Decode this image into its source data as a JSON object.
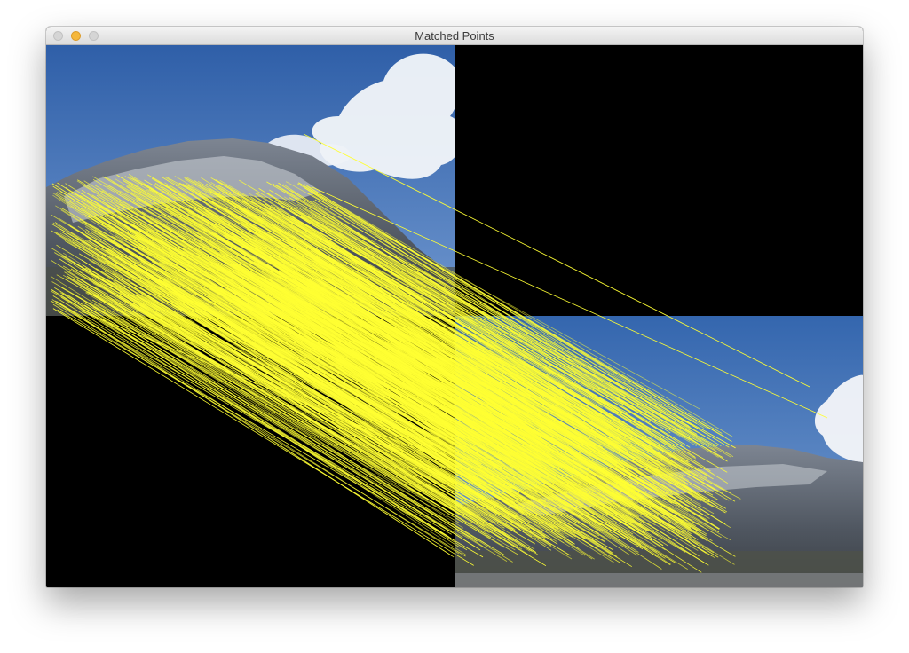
{
  "window": {
    "title": "Matched Points",
    "buttons": {
      "close": "close-icon",
      "minimize": "minimize-icon",
      "zoom": "zoom-icon"
    }
  },
  "canvas": {
    "background": "#000000",
    "match_line_color": "#ffff33",
    "sky_color": "#3c6cb1",
    "cloud_color": "#ffffff",
    "mountain_color": "#64707e"
  }
}
